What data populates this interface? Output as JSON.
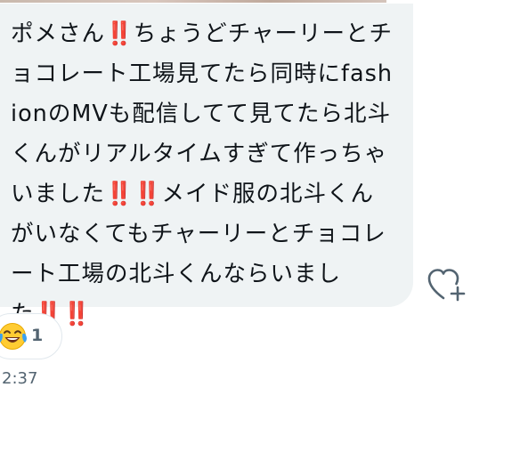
{
  "message": {
    "segments": [
      {
        "text": "ポメさん",
        "type": "text"
      },
      {
        "text": "‼️",
        "type": "emoji"
      },
      {
        "text": "ちょうどチャーリーとチョコレート工場見てたら同時にfashionのMVも配信してて見てたら北斗くんがリアルタイムすぎて作っちゃいました",
        "type": "text"
      },
      {
        "text": "‼️",
        "type": "emoji"
      },
      {
        "text": "‼️",
        "type": "emoji"
      },
      {
        "text": "メイド服の北斗くんがいなくてもチャーリーとチョコレート工場の北斗くんならいました",
        "type": "text"
      },
      {
        "text": "‼️",
        "type": "emoji"
      },
      {
        "text": "‼️",
        "type": "emoji"
      }
    ]
  },
  "reaction": {
    "emoji": "😂",
    "icon": "face-with-tears-of-joy-icon",
    "count": "1"
  },
  "timestamp": "2:37",
  "icons": {
    "add_reaction": "heart-plus-icon"
  },
  "colors": {
    "bubble": "#eff3f4",
    "text": "#0f1419",
    "emoji_red": "#e0142d",
    "muted": "#536471"
  }
}
